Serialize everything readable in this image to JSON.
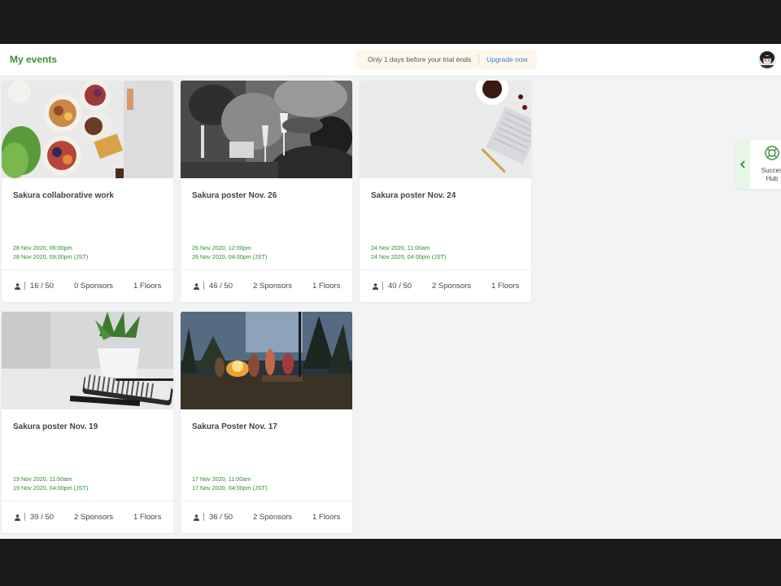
{
  "header": {
    "title": "My events",
    "trial_text": "Only 1 days before your trial ends",
    "upgrade_label": "Upgrade now"
  },
  "success_hub": {
    "label_line1": "Succes",
    "label_line2": "Hub"
  },
  "events": [
    {
      "title": "Sakura collaborative work",
      "start": "28 Nov 2020, 06:00pm",
      "end": "28 Nov 2020, 09:00pm (JST)",
      "attendees": "16 / 50",
      "sponsors": "0 Sponsors",
      "floors": "1 Floors",
      "image": "food-table-photo"
    },
    {
      "title": "Sakura poster Nov. 26",
      "start": "26 Nov 2020, 12:00pm",
      "end": "26 Nov 2020, 04:00pm (JST)",
      "attendees": "46 / 50",
      "sponsors": "2 Sponsors",
      "floors": "1 Floors",
      "image": "party-toast-photo"
    },
    {
      "title": "Sakura poster Nov. 24",
      "start": "24 Nov 2020, 11:00am",
      "end": "24 Nov 2020, 04:00pm (JST)",
      "attendees": "40 / 50",
      "sponsors": "2 Sponsors",
      "floors": "1 Floors",
      "image": "desk-keyboard-photo"
    },
    {
      "title": "Sakura poster Nov. 19",
      "start": "19 Nov 2020, 11:00am",
      "end": "19 Nov 2020, 04:00pm (JST)",
      "attendees": "39 / 50",
      "sponsors": "2 Sponsors",
      "floors": "1 Floors",
      "image": "notebook-plant-photo"
    },
    {
      "title": "Sakura Poster Nov. 17",
      "start": "17 Nov 2020, 11:00am",
      "end": "17 Nov 2020, 04:00pm (JST)",
      "attendees": "36 / 50",
      "sponsors": "2 Sponsors",
      "floors": "1 Floors",
      "image": "campfire-photo"
    }
  ],
  "colors": {
    "accent": "#3e8e3a",
    "link": "#3a7bd5",
    "date": "#2e8b2e"
  }
}
